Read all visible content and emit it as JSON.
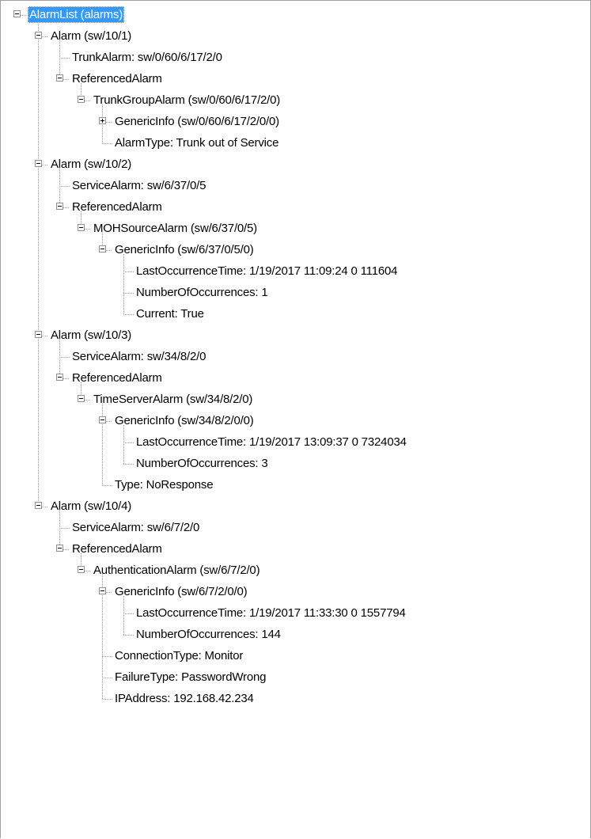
{
  "colors": {
    "selection": "#3399ff",
    "line": "#a0a0a0",
    "expander_border": "#919191"
  },
  "tree": {
    "nodes": [
      {
        "label": "AlarmList (alarms)",
        "depth": 0,
        "expander": "minus",
        "selected": true
      },
      {
        "label": "Alarm (sw/10/1)",
        "depth": 1,
        "expander": "minus"
      },
      {
        "label": "TrunkAlarm: sw/0/60/6/17/2/0",
        "depth": 2,
        "expander": "none"
      },
      {
        "label": "ReferencedAlarm",
        "depth": 2,
        "expander": "minus"
      },
      {
        "label": "TrunkGroupAlarm (sw/0/60/6/17/2/0)",
        "depth": 3,
        "expander": "minus"
      },
      {
        "label": "GenericInfo (sw/0/60/6/17/2/0/0)",
        "depth": 4,
        "expander": "plus"
      },
      {
        "label": "AlarmType: Trunk out of Service",
        "depth": 4,
        "expander": "none"
      },
      {
        "label": "Alarm (sw/10/2)",
        "depth": 1,
        "expander": "minus"
      },
      {
        "label": "ServiceAlarm: sw/6/37/0/5",
        "depth": 2,
        "expander": "none"
      },
      {
        "label": "ReferencedAlarm",
        "depth": 2,
        "expander": "minus"
      },
      {
        "label": "MOHSourceAlarm (sw/6/37/0/5)",
        "depth": 3,
        "expander": "minus"
      },
      {
        "label": "GenericInfo (sw/6/37/0/5/0)",
        "depth": 4,
        "expander": "minus"
      },
      {
        "label": "LastOccurrenceTime: 1/19/2017 11:09:24 0 111604",
        "depth": 5,
        "expander": "none"
      },
      {
        "label": "NumberOfOccurrences: 1",
        "depth": 5,
        "expander": "none"
      },
      {
        "label": "Current: True",
        "depth": 5,
        "expander": "none"
      },
      {
        "label": "Alarm (sw/10/3)",
        "depth": 1,
        "expander": "minus"
      },
      {
        "label": "ServiceAlarm: sw/34/8/2/0",
        "depth": 2,
        "expander": "none"
      },
      {
        "label": "ReferencedAlarm",
        "depth": 2,
        "expander": "minus"
      },
      {
        "label": "TimeServerAlarm (sw/34/8/2/0)",
        "depth": 3,
        "expander": "minus"
      },
      {
        "label": "GenericInfo (sw/34/8/2/0/0)",
        "depth": 4,
        "expander": "minus"
      },
      {
        "label": "LastOccurrenceTime: 1/19/2017 13:09:37 0 7324034",
        "depth": 5,
        "expander": "none"
      },
      {
        "label": "NumberOfOccurrences: 3",
        "depth": 5,
        "expander": "none"
      },
      {
        "label": "Type: NoResponse",
        "depth": 4,
        "expander": "none"
      },
      {
        "label": "Alarm (sw/10/4)",
        "depth": 1,
        "expander": "minus"
      },
      {
        "label": "ServiceAlarm: sw/6/7/2/0",
        "depth": 2,
        "expander": "none"
      },
      {
        "label": "ReferencedAlarm",
        "depth": 2,
        "expander": "minus"
      },
      {
        "label": "AuthenticationAlarm (sw/6/7/2/0)",
        "depth": 3,
        "expander": "minus"
      },
      {
        "label": "GenericInfo (sw/6/7/2/0/0)",
        "depth": 4,
        "expander": "minus"
      },
      {
        "label": "LastOccurrenceTime: 1/19/2017 11:33:30 0 1557794",
        "depth": 5,
        "expander": "none"
      },
      {
        "label": "NumberOfOccurrences: 144",
        "depth": 5,
        "expander": "none"
      },
      {
        "label": "ConnectionType: Monitor",
        "depth": 4,
        "expander": "none"
      },
      {
        "label": "FailureType: PasswordWrong",
        "depth": 4,
        "expander": "none"
      },
      {
        "label": "IPAddress: 192.168.42.234",
        "depth": 4,
        "expander": "none"
      }
    ]
  }
}
